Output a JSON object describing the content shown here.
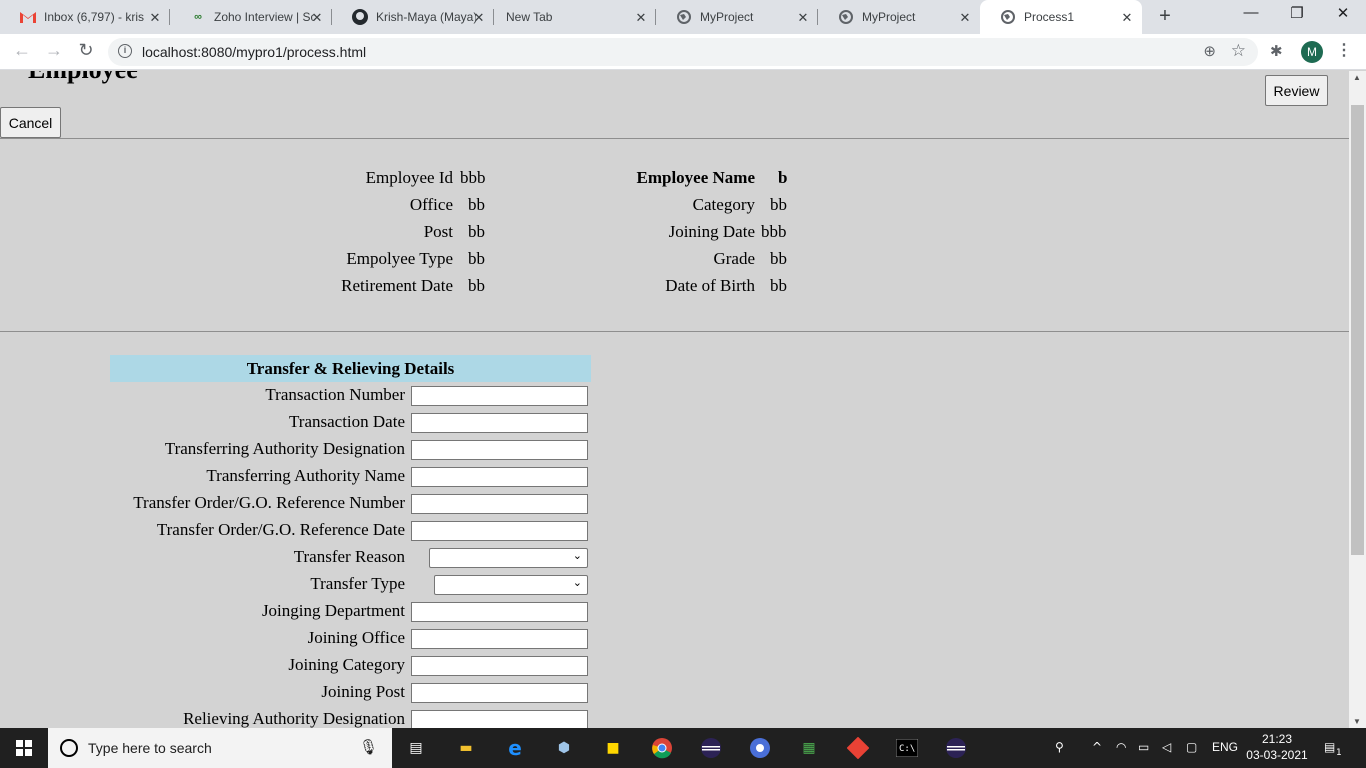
{
  "browser": {
    "tabs": [
      {
        "title": "Inbox (6,797) - kris",
        "icon": "gmail-icon"
      },
      {
        "title": "Zoho Interview | Sc",
        "icon": "zoho-icon"
      },
      {
        "title": "Krish-Maya (Maya)",
        "icon": "github-icon"
      },
      {
        "title": "New Tab",
        "icon": ""
      },
      {
        "title": "MyProject",
        "icon": "globe-icon"
      },
      {
        "title": "MyProject",
        "icon": "globe-icon"
      },
      {
        "title": "Process1",
        "icon": "globe-icon"
      }
    ],
    "active_tab": 6,
    "url": "localhost:8080/mypro1/process.html",
    "profile_initial": "M"
  },
  "page": {
    "review_label": "Review",
    "cancel_label": "Cancel",
    "employee": {
      "left": [
        {
          "label": "Employee Id",
          "value": "bbb"
        },
        {
          "label": "Office",
          "value": "bb"
        },
        {
          "label": "Post",
          "value": "bb"
        },
        {
          "label": "Empolyee Type",
          "value": "bb"
        },
        {
          "label": "Retirement Date",
          "value": "bb"
        }
      ],
      "right": [
        {
          "label": "Employee Name",
          "value": "b"
        },
        {
          "label": "Category",
          "value": "bb"
        },
        {
          "label": "Joining Date",
          "value": "bbb"
        },
        {
          "label": "Grade",
          "value": "bb"
        },
        {
          "label": "Date of Birth",
          "value": "bb"
        }
      ]
    },
    "section_title": "Transfer & Relieving Details",
    "fields": [
      {
        "label": "Transaction Number",
        "type": "text",
        "value": ""
      },
      {
        "label": "Transaction Date",
        "type": "text",
        "value": ""
      },
      {
        "label": "Transferring Authority Designation",
        "type": "text",
        "value": ""
      },
      {
        "label": "Transferring Authority Name",
        "type": "text",
        "value": ""
      },
      {
        "label": "Transfer Order/G.O. Reference Number",
        "type": "text",
        "value": ""
      },
      {
        "label": "Transfer Order/G.O. Reference Date",
        "type": "text",
        "value": ""
      },
      {
        "label": "Transfer Reason",
        "type": "select",
        "value": ""
      },
      {
        "label": "Transfer Type",
        "type": "select",
        "value": ""
      },
      {
        "label": "Joinging Department",
        "type": "text",
        "value": ""
      },
      {
        "label": "Joining Office",
        "type": "text",
        "value": ""
      },
      {
        "label": "Joining Category",
        "type": "text",
        "value": ""
      },
      {
        "label": "Joining Post",
        "type": "text",
        "value": ""
      },
      {
        "label": "Relieving Authority Designation",
        "type": "text",
        "value": ""
      }
    ]
  },
  "taskbar": {
    "search_placeholder": "Type here to search",
    "language": "ENG",
    "time": "21:23",
    "date": "03-03-2021",
    "notification_count": "1"
  }
}
